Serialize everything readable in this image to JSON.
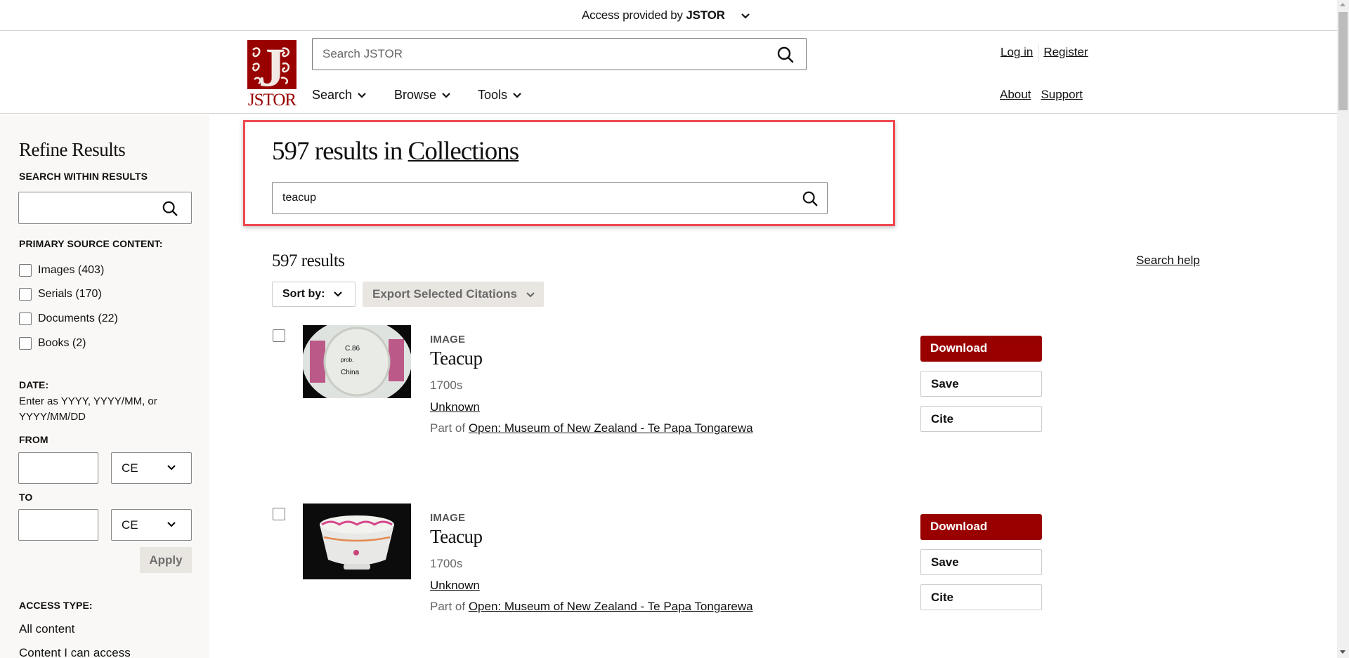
{
  "banner": {
    "prefix": "Access provided by",
    "provider": "JSTOR"
  },
  "header": {
    "logo_text": "JSTOR",
    "logo_letter": "J",
    "search_placeholder": "Search JSTOR",
    "nav": [
      {
        "label": "Search"
      },
      {
        "label": "Browse"
      },
      {
        "label": "Tools"
      }
    ],
    "login_label": "Log in",
    "register_label": "Register",
    "about_label": "About",
    "support_label": "Support"
  },
  "sidebar": {
    "title": "Refine Results",
    "search_within_label": "SEARCH WITHIN RESULTS",
    "search_within_value": "",
    "primary_source_label": "PRIMARY SOURCE CONTENT:",
    "facets": [
      {
        "label": "Images (403)",
        "checked": false
      },
      {
        "label": "Serials (170)",
        "checked": false
      },
      {
        "label": "Documents (22)",
        "checked": false
      },
      {
        "label": "Books (2)",
        "checked": false
      }
    ],
    "date_label": "DATE:",
    "date_hint": "Enter as YYYY, YYYY/MM, or YYYY/MM/DD",
    "from_label": "FROM",
    "to_label": "TO",
    "from_value": "",
    "to_value": "",
    "from_era": "CE",
    "to_era": "CE",
    "apply_label": "Apply",
    "access_type_label": "ACCESS TYPE:",
    "access_options": [
      {
        "label": "All content"
      },
      {
        "label": "Content I can access"
      }
    ]
  },
  "main": {
    "heading_prefix": "597 results in",
    "heading_link": "Collections",
    "query": "teacup",
    "results_count": "597 results",
    "search_help": "Search help",
    "sort_label": "Sort by:",
    "export_label": "Export Selected Citations",
    "results": [
      {
        "type": "IMAGE",
        "title": "Teacup",
        "date": "1700s",
        "creator": "Unknown",
        "part_of_prefix": "Part of",
        "collection": "Open: Museum of New Zealand - Te Papa Tongarewa",
        "thumbnail": "teacup-underside-photo",
        "download_label": "Download",
        "save_label": "Save",
        "cite_label": "Cite"
      },
      {
        "type": "IMAGE",
        "title": "Teacup",
        "date": "1700s",
        "creator": "Unknown",
        "part_of_prefix": "Part of",
        "collection": "Open: Museum of New Zealand - Te Papa Tongarewa",
        "thumbnail": "teacup-side-photo",
        "download_label": "Download",
        "save_label": "Save",
        "cite_label": "Cite"
      }
    ]
  },
  "colors": {
    "brand_red": "#990000",
    "highlight_border": "#f0474f",
    "sidebar_bg": "#f9f8f6",
    "disabled_button_bg": "#e9e6e1"
  }
}
